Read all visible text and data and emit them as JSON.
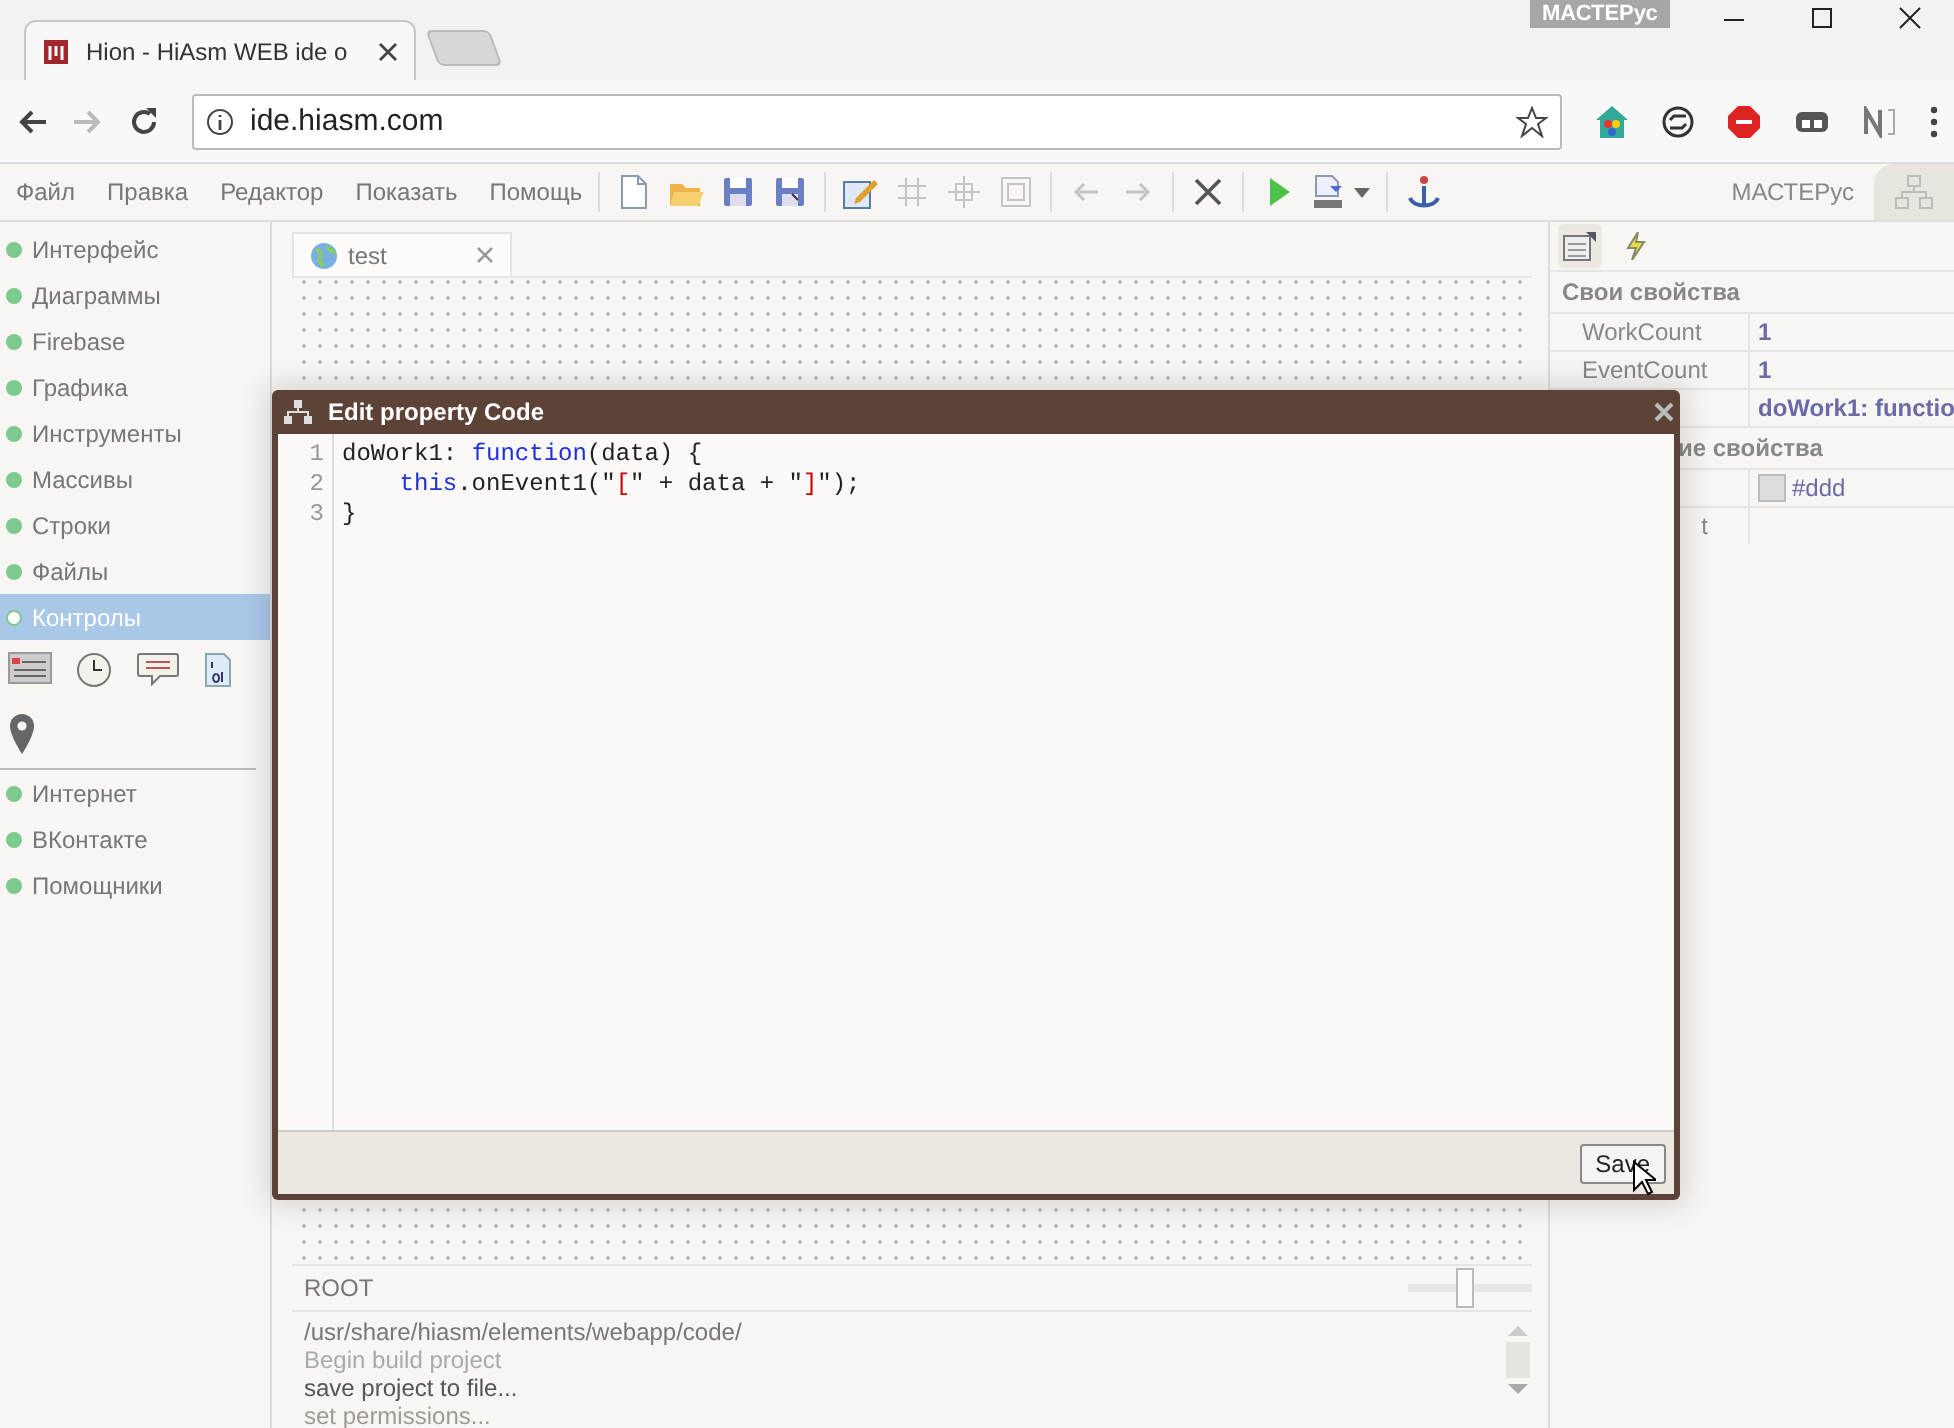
{
  "browser": {
    "tab_title": "Hion - HiAsm WEB ide o",
    "profile_badge": "МАСТЕРус",
    "url": "ide.hiasm.com"
  },
  "menu": [
    "Файл",
    "Правка",
    "Редактор",
    "Показать",
    "Помощь"
  ],
  "toolbar_groups": [
    {
      "items": [
        {
          "kind": "new",
          "disabled": false
        },
        {
          "kind": "open",
          "disabled": false
        },
        {
          "kind": "save",
          "disabled": false
        },
        {
          "kind": "save-all",
          "disabled": false
        }
      ]
    },
    {
      "items": [
        {
          "kind": "edit",
          "disabled": false
        },
        {
          "kind": "grid",
          "disabled": true
        },
        {
          "kind": "center",
          "disabled": true
        },
        {
          "kind": "frame",
          "disabled": true
        }
      ]
    },
    {
      "items": [
        {
          "kind": "back",
          "disabled": true
        },
        {
          "kind": "forward",
          "disabled": true
        }
      ]
    },
    {
      "items": [
        {
          "kind": "delete",
          "disabled": false
        }
      ]
    },
    {
      "items": [
        {
          "kind": "run",
          "disabled": false
        },
        {
          "kind": "build",
          "disabled": false
        }
      ]
    },
    {
      "items": [
        {
          "kind": "anchor",
          "disabled": false
        }
      ]
    }
  ],
  "user": "МАСТЕРус",
  "sidebar": {
    "items": [
      {
        "label": "Интерфейс",
        "selected": false
      },
      {
        "label": "Диаграммы",
        "selected": false
      },
      {
        "label": "Firebase",
        "selected": false
      },
      {
        "label": "Графика",
        "selected": false
      },
      {
        "label": "Инструменты",
        "selected": false
      },
      {
        "label": "Массивы",
        "selected": false
      },
      {
        "label": "Строки",
        "selected": false
      },
      {
        "label": "Файлы",
        "selected": false
      },
      {
        "label": "Контролы",
        "selected": true
      },
      {
        "label": "Интернет",
        "selected": false
      },
      {
        "label": "ВКонтакте",
        "selected": false
      },
      {
        "label": "Помощники",
        "selected": false
      }
    ]
  },
  "editor_tabs": [
    {
      "label": "test",
      "selected": true
    }
  ],
  "status": {
    "path": "ROOT",
    "zoom": {
      "level": 0.45
    }
  },
  "log": [
    {
      "text": "/usr/share/hiasm/elements/webapp/code/",
      "kind": "path"
    },
    {
      "text": "Begin build project",
      "kind": "info"
    },
    {
      "text": "save project to file...",
      "kind": "action"
    },
    {
      "text": "set permissions...",
      "kind": "faint"
    }
  ],
  "properties": {
    "tabs": [
      {
        "kind": "properties",
        "selected": true
      },
      {
        "kind": "events",
        "selected": false
      }
    ],
    "groups": [
      {
        "title": "Свои свойства",
        "rows": [
          {
            "name": "WorkCount",
            "value": "1",
            "kind": "text"
          },
          {
            "name": "EventCount",
            "value": "1",
            "kind": "text"
          },
          {
            "value": "doWork1: functio",
            "kind": "text"
          }
        ]
      },
      {
        "title": "ие свойства",
        "rows": [
          {
            "value": "#ddd",
            "kind": "color"
          },
          {
            "name": "t",
            "kind": "text"
          }
        ]
      }
    ]
  },
  "dialog": {
    "title": "Edit property Code",
    "lines": [
      {
        "number": "1",
        "tokens": [
          {
            "t": "doWork1: ",
            "kind": "plain"
          },
          {
            "t": "function",
            "kind": "keyword"
          },
          {
            "t": "(data) {",
            "kind": "plain"
          }
        ]
      },
      {
        "number": "2",
        "tokens": [
          {
            "t": "    this",
            "kind": "keyword"
          },
          {
            "t": ".onEvent1(\"",
            "kind": "plain"
          },
          {
            "t": "[",
            "kind": "string"
          },
          {
            "t": "\" + data + \"",
            "kind": "plain"
          },
          {
            "t": "]",
            "kind": "string"
          },
          {
            "t": "\");",
            "kind": "plain"
          }
        ]
      },
      {
        "number": "3",
        "tokens": [
          {
            "t": "}",
            "kind": "plain"
          }
        ]
      }
    ],
    "button": "Save"
  }
}
